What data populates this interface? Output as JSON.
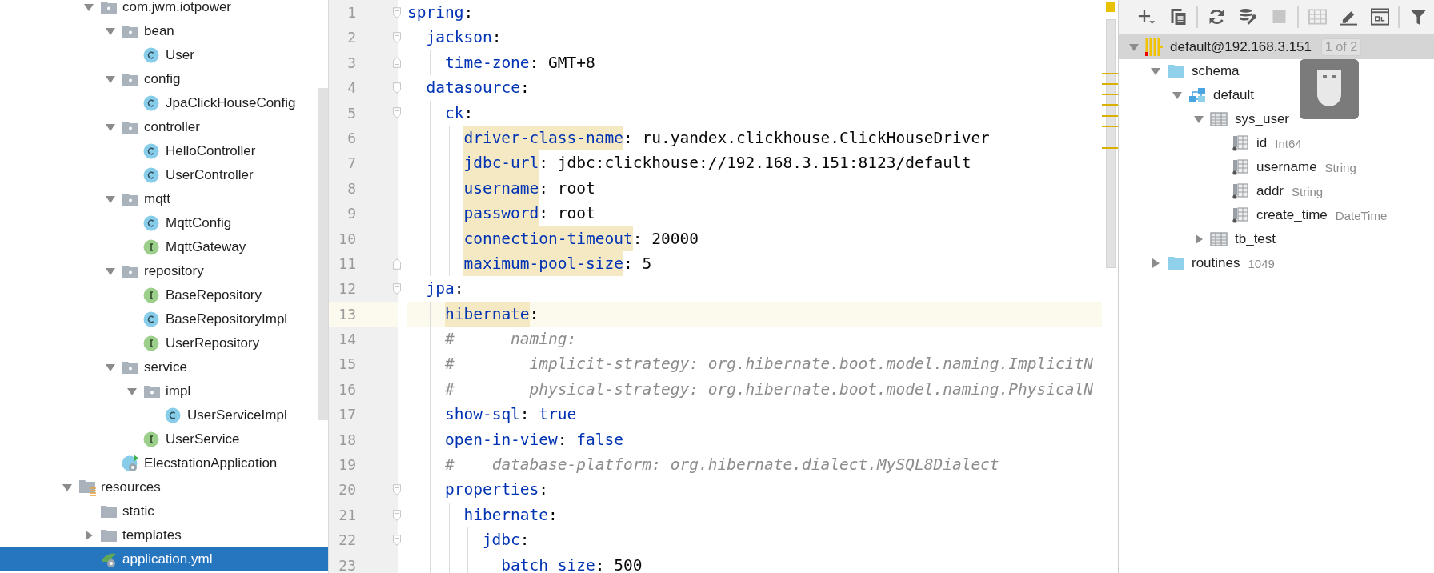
{
  "project_tree": {
    "items": [
      {
        "children": [
          {
            "label": "com.jwm.iotpower",
            "kind": "package",
            "expanded": true,
            "selected": false,
            "children": [
              {
                "label": "bean",
                "kind": "package",
                "expanded": true,
                "selected": false,
                "children": [
                  {
                    "label": "User",
                    "kind": "class",
                    "selected": false
                  }
                ]
              },
              {
                "label": "config",
                "kind": "package",
                "expanded": true,
                "selected": false,
                "children": [
                  {
                    "label": "JpaClickHouseConfig",
                    "kind": "class",
                    "selected": false
                  }
                ]
              },
              {
                "label": "controller",
                "kind": "package",
                "expanded": true,
                "selected": false,
                "children": [
                  {
                    "label": "HelloController",
                    "kind": "class",
                    "selected": false
                  },
                  {
                    "label": "UserController",
                    "kind": "class",
                    "selected": false
                  }
                ]
              },
              {
                "label": "mqtt",
                "kind": "package",
                "expanded": true,
                "selected": false,
                "children": [
                  {
                    "label": "MqttConfig",
                    "kind": "class",
                    "selected": false
                  },
                  {
                    "label": "MqttGateway",
                    "kind": "interface",
                    "selected": false
                  }
                ]
              },
              {
                "label": "repository",
                "kind": "package",
                "expanded": true,
                "selected": false,
                "children": [
                  {
                    "label": "BaseRepository",
                    "kind": "interface",
                    "selected": false
                  },
                  {
                    "label": "BaseRepositoryImpl",
                    "kind": "class",
                    "selected": false
                  },
                  {
                    "label": "UserRepository",
                    "kind": "interface",
                    "selected": false
                  }
                ]
              },
              {
                "label": "service",
                "kind": "package",
                "expanded": true,
                "selected": false,
                "children": [
                  {
                    "label": "impl",
                    "kind": "package",
                    "expanded": true,
                    "selected": false,
                    "children": [
                      {
                        "label": "UserServiceImpl",
                        "kind": "class",
                        "selected": false
                      }
                    ]
                  },
                  {
                    "label": "UserService",
                    "kind": "interface",
                    "selected": false
                  }
                ]
              },
              {
                "label": "ElecstationApplication",
                "kind": "app",
                "selected": false
              }
            ]
          }
        ]
      },
      {
        "label": "resources",
        "kind": "resources",
        "expanded": true,
        "selected": false,
        "children": [
          {
            "label": "static",
            "kind": "folder",
            "selected": false
          },
          {
            "label": "templates",
            "kind": "folder",
            "expanded": false,
            "selected": false
          },
          {
            "label": "application.yml",
            "kind": "yaml",
            "selected": true
          }
        ]
      }
    ]
  },
  "editor": {
    "lines": [
      {
        "number": "1",
        "kind": "key",
        "key": "spring",
        "colon": ":",
        "marked": false,
        "current": false,
        "children": [
          {
            "number": "2",
            "kind": "key",
            "key": "jackson",
            "colon": ":",
            "marked": false,
            "current": false,
            "children": [
              {
                "number": "3",
                "kind": "key",
                "key": "time-zone",
                "colon": ":",
                "value": {
                  "text": "GMT+8",
                  "kind": "plain"
                },
                "marked": false,
                "current": false
              }
            ]
          },
          {
            "number": "4",
            "kind": "key",
            "key": "datasource",
            "colon": ":",
            "marked": false,
            "current": false,
            "children": [
              {
                "number": "5",
                "kind": "key",
                "key": "ck",
                "colon": ":",
                "marked": false,
                "current": false,
                "children": [
                  {
                    "number": "6",
                    "kind": "key",
                    "key": "driver-class-name",
                    "colon": ":",
                    "value": {
                      "text": "ru.yandex.clickhouse.ClickHouseDriver",
                      "kind": "plain"
                    },
                    "marked": true,
                    "current": false
                  },
                  {
                    "number": "7",
                    "kind": "key",
                    "key": "jdbc-url",
                    "colon": ":",
                    "value": {
                      "text": "jdbc:clickhouse://192.168.3.151:8123/default",
                      "kind": "plain"
                    },
                    "marked": true,
                    "current": false
                  },
                  {
                    "number": "8",
                    "kind": "key",
                    "key": "username",
                    "colon": ":",
                    "value": {
                      "text": "root",
                      "kind": "plain"
                    },
                    "marked": true,
                    "current": false
                  },
                  {
                    "number": "9",
                    "kind": "key",
                    "key": "password",
                    "colon": ":",
                    "value": {
                      "text": "root",
                      "kind": "plain"
                    },
                    "marked": true,
                    "current": false
                  },
                  {
                    "number": "10",
                    "kind": "key",
                    "key": "connection-timeout",
                    "colon": ":",
                    "value": {
                      "text": "20000",
                      "kind": "plain"
                    },
                    "marked": true,
                    "current": false
                  },
                  {
                    "number": "11",
                    "kind": "key",
                    "key": "maximum-pool-size",
                    "colon": ":",
                    "value": {
                      "text": "5",
                      "kind": "plain"
                    },
                    "marked": true,
                    "current": false
                  }
                ]
              }
            ]
          },
          {
            "number": "12",
            "kind": "key",
            "key": "jpa",
            "colon": ":",
            "marked": false,
            "current": false,
            "children": [
              {
                "number": "13",
                "kind": "key",
                "key": "hibernate",
                "colon": ":",
                "marked": true,
                "current": true
              },
              {
                "number": "14",
                "kind": "comment",
                "text": "#      naming:",
                "current": false
              },
              {
                "number": "15",
                "kind": "comment",
                "text": "#        implicit-strategy: org.hibernate.boot.model.naming.ImplicitN",
                "current": false
              },
              {
                "number": "16",
                "kind": "comment",
                "text": "#        physical-strategy: org.hibernate.boot.model.naming.PhysicalN",
                "current": false
              },
              {
                "number": "17",
                "kind": "key",
                "key": "show-sql",
                "colon": ":",
                "value": {
                  "text": "true",
                  "kind": "keyword"
                },
                "marked": false,
                "current": false
              },
              {
                "number": "18",
                "kind": "key",
                "key": "open-in-view",
                "colon": ":",
                "value": {
                  "text": "false",
                  "kind": "keyword"
                },
                "marked": false,
                "current": false
              },
              {
                "number": "19",
                "kind": "comment",
                "text": "#    database-platform: org.hibernate.dialect.MySQL8Dialect",
                "current": false
              },
              {
                "number": "20",
                "kind": "key",
                "key": "properties",
                "colon": ":",
                "marked": false,
                "current": false,
                "children": [
                  {
                    "number": "21",
                    "kind": "key",
                    "key": "hibernate",
                    "colon": ":",
                    "marked": false,
                    "current": false,
                    "children": [
                      {
                        "number": "22",
                        "kind": "key",
                        "key": "jdbc",
                        "colon": ":",
                        "marked": false,
                        "current": false,
                        "children": [
                          {
                            "number": "23",
                            "kind": "key",
                            "key": "batch_size",
                            "colon": ":",
                            "value": {
                              "text": "500",
                              "kind": "plain"
                            },
                            "marked": false,
                            "current": false
                          }
                        ]
                      }
                    ]
                  }
                ]
              }
            ]
          }
        ]
      }
    ]
  },
  "database": {
    "toolbar": {
      "groups": [
        {
          "buttons": [
            {
              "kind": "add",
              "disabled": false
            },
            {
              "kind": "copy",
              "disabled": false
            }
          ]
        },
        {
          "buttons": [
            {
              "kind": "refresh",
              "disabled": false
            },
            {
              "kind": "tools",
              "disabled": false
            },
            {
              "kind": "stop",
              "disabled": true
            }
          ]
        },
        {
          "buttons": [
            {
              "kind": "table",
              "disabled": true
            },
            {
              "kind": "edit",
              "disabled": false
            },
            {
              "kind": "console",
              "disabled": false
            }
          ]
        },
        {
          "buttons": [
            {
              "kind": "filter",
              "disabled": false
            }
          ]
        }
      ]
    },
    "items": [
      {
        "label": "default@192.168.3.151",
        "detail": "1 of 2",
        "kind": "datasource",
        "expanded": true,
        "selected": true,
        "children": [
          {
            "label": "schema",
            "kind": "folder",
            "expanded": true,
            "selected": false,
            "children": [
              {
                "label": "default",
                "kind": "schema",
                "expanded": true,
                "selected": false,
                "children": [
                  {
                    "label": "sys_user",
                    "kind": "table",
                    "expanded": true,
                    "selected": false,
                    "children": [
                      {
                        "label": "id",
                        "detail": "Int64",
                        "kind": "column",
                        "selected": false
                      },
                      {
                        "label": "username",
                        "detail": "String",
                        "kind": "column",
                        "selected": false
                      },
                      {
                        "label": "addr",
                        "detail": "String",
                        "kind": "column",
                        "selected": false
                      },
                      {
                        "label": "create_time",
                        "detail": "DateTime",
                        "kind": "column",
                        "selected": false
                      }
                    ]
                  },
                  {
                    "label": "tb_test",
                    "kind": "table",
                    "expanded": false,
                    "selected": false
                  }
                ]
              }
            ]
          },
          {
            "label": "routines",
            "detail": "1049",
            "kind": "folder",
            "expanded": false,
            "selected": false
          }
        ]
      }
    ]
  }
}
